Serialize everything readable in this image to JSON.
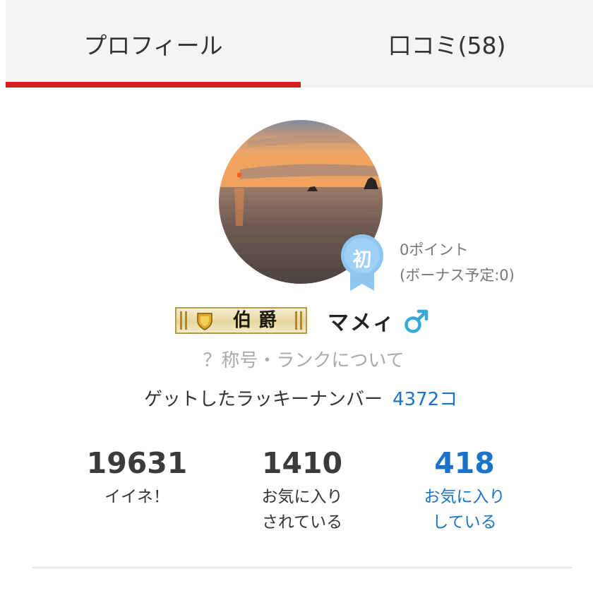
{
  "tabs": {
    "profile": "プロフィール",
    "reviews": "口コミ(58)",
    "active": "profile"
  },
  "profile": {
    "avatar_alt": "sunset-over-sea",
    "rank_badge": "初",
    "points_line1": "0ポイント",
    "points_line2": "(ボーナス予定:0)",
    "title": "伯爵",
    "username": "マメィ",
    "gender_icon": "male-icon",
    "rank_link": "？称号・ランクについて",
    "lucky_label": "ゲットしたラッキーナンバー",
    "lucky_value": "4372コ"
  },
  "stats": {
    "likes": {
      "value": "19631",
      "label": "イイネ！"
    },
    "favored": {
      "value": "1410",
      "label_line1": "お気に入り",
      "label_line2": "されている"
    },
    "favoring": {
      "value": "418",
      "label_line1": "お気に入り",
      "label_line2": "している"
    }
  },
  "colors": {
    "accent_red": "#d42220",
    "link_blue": "#1a73c8",
    "badge_blue": "#8ec6f1",
    "gender_blue": "#37a9d8",
    "plaque_gold": "#e6d59d"
  }
}
